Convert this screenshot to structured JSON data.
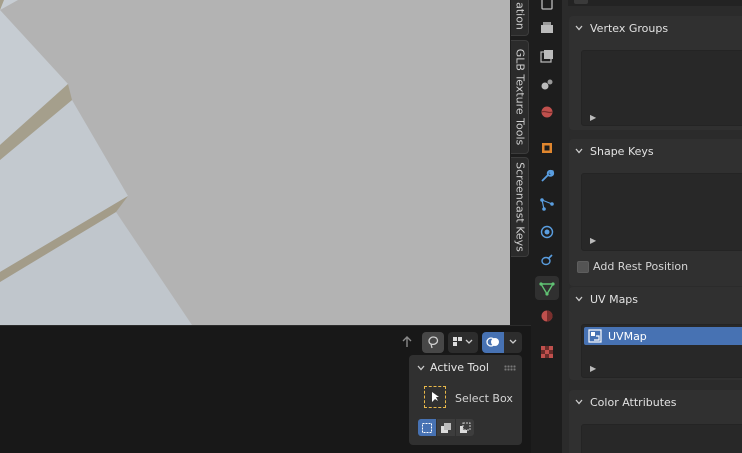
{
  "sidebar_tabs": [
    "ation",
    "GLB Texture Tools",
    "Screencast Keys"
  ],
  "active_tool": {
    "title": "Active Tool",
    "tool_name": "Select Box"
  },
  "properties": {
    "vertex_groups": {
      "title": "Vertex Groups"
    },
    "shape_keys": {
      "title": "Shape Keys"
    },
    "add_rest_position": {
      "label": "Add Rest Position",
      "checked": false
    },
    "uv_maps": {
      "title": "UV Maps",
      "items": [
        "UVMap"
      ]
    },
    "color_attributes": {
      "title": "Color Attributes"
    }
  },
  "colors": {
    "accent": "#4772b3",
    "viewport_bg": "#b3b3b3",
    "object_face": "#c4cad0",
    "object_edge": "#a39c89",
    "data_tab_green": "#61c374"
  },
  "icons": {
    "properties_tabs": [
      "tool-icon",
      "render-icon",
      "output-icon",
      "view-layer-icon",
      "scene-icon",
      "world-icon",
      "object-icon",
      "modifier-icon",
      "particles-icon",
      "physics-icon",
      "constraints-icon",
      "data-icon",
      "material-icon",
      "texture-icon"
    ]
  }
}
